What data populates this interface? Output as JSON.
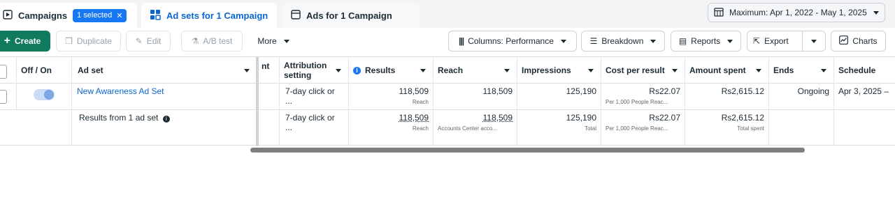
{
  "tabs": {
    "campaigns": {
      "label": "Campaigns",
      "selected_pill": "1 selected"
    },
    "adsets": {
      "label": "Ad sets for 1 Campaign"
    },
    "ads": {
      "label": "Ads for 1 Campaign"
    }
  },
  "date_range": {
    "label": "Maximum: Apr 1, 2022 - May 1, 2025"
  },
  "toolbar": {
    "create": "Create",
    "duplicate": "Duplicate",
    "edit": "Edit",
    "ab_test": "A/B test",
    "more": "More",
    "columns": "Columns: Performance",
    "breakdown": "Breakdown",
    "reports": "Reports",
    "export": "Export",
    "charts": "Charts"
  },
  "headers": {
    "off_on": "Off / On",
    "ad_set": "Ad set",
    "nt": "nt",
    "attribution": "Attribution setting",
    "results": "Results",
    "reach": "Reach",
    "impressions": "Impressions",
    "cost_per_result": "Cost per result",
    "amount_spent": "Amount spent",
    "ends": "Ends",
    "schedule": "Schedule"
  },
  "rows": [
    {
      "ad_set": "New Awareness Ad Set",
      "attribution": "7-day click or ...",
      "results": "118,509",
      "results_sub": "Reach",
      "reach": "118,509",
      "impressions": "125,190",
      "cost_per_result": "Rs22.07",
      "cost_sub": "Per 1,000 People Reac...",
      "amount_spent": "Rs2,615.12",
      "ends": "Ongoing",
      "schedule": "Apr 3, 2025 – "
    }
  ],
  "summary": {
    "label": "Results from 1 ad set",
    "attribution": "7-day click or ...",
    "results": "118,509",
    "results_sub": "Reach",
    "reach": "118,509",
    "reach_sub": "Accounts Center acco...",
    "impressions": "125,190",
    "impressions_sub": "Total",
    "cost_per_result": "Rs22.07",
    "cost_sub": "Per 1,000 People Reac...",
    "amount_spent": "Rs2,615.12",
    "amount_sub": "Total spent"
  },
  "colors": {
    "accent": "#1877f2",
    "create": "#0f7b5c",
    "link": "#0a66d0"
  },
  "icons": [
    "campaign-icon",
    "close-icon",
    "adsets-icon",
    "ads-icon",
    "calendar-icon",
    "plus-icon",
    "duplicate-icon",
    "edit-icon",
    "flask-icon",
    "columns-icon",
    "breakdown-icon",
    "reports-icon",
    "export-icon",
    "chart-icon",
    "info-icon"
  ]
}
